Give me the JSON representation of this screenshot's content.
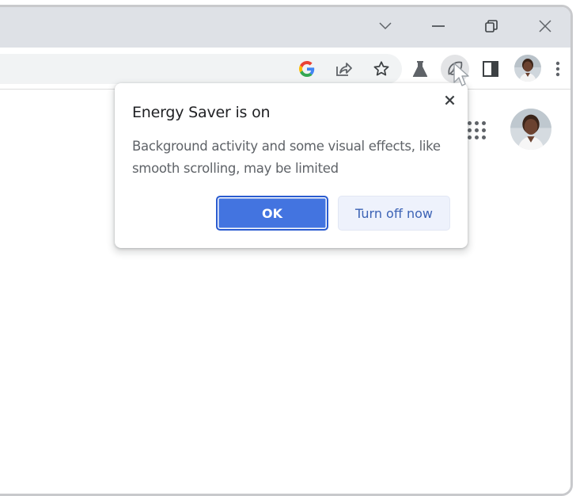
{
  "window": {
    "controls": {
      "tab_search_icon": "chevron-down-icon",
      "minimize_icon": "minimize-icon",
      "restore_icon": "restore-icon",
      "close_icon": "close-icon"
    }
  },
  "toolbar": {
    "omnibox_icons": [
      "google-icon",
      "share-icon",
      "bookmark-star-icon"
    ],
    "icons": [
      "labs-flask-icon",
      "energy-saver-leaf-icon",
      "side-panel-icon",
      "profile-avatar",
      "more-menu-icon"
    ],
    "energy_saver_active": true
  },
  "page": {
    "apps_icon": "apps-grid-icon",
    "avatar": "account-avatar"
  },
  "energy_saver_bubble": {
    "title": "Energy Saver is on",
    "body": "Background activity and some visual effects, like smooth scrolling, may be limited",
    "ok_label": "OK",
    "turn_off_label": "Turn off now",
    "close_icon": "close-icon"
  },
  "colors": {
    "titlebar": "#dee1e6",
    "omnibox": "#f1f3f4",
    "primary_button": "#4374e0",
    "secondary_button": "#eef2fc",
    "secondary_text": "#3c63b5",
    "icon_gray": "#5f6368"
  }
}
